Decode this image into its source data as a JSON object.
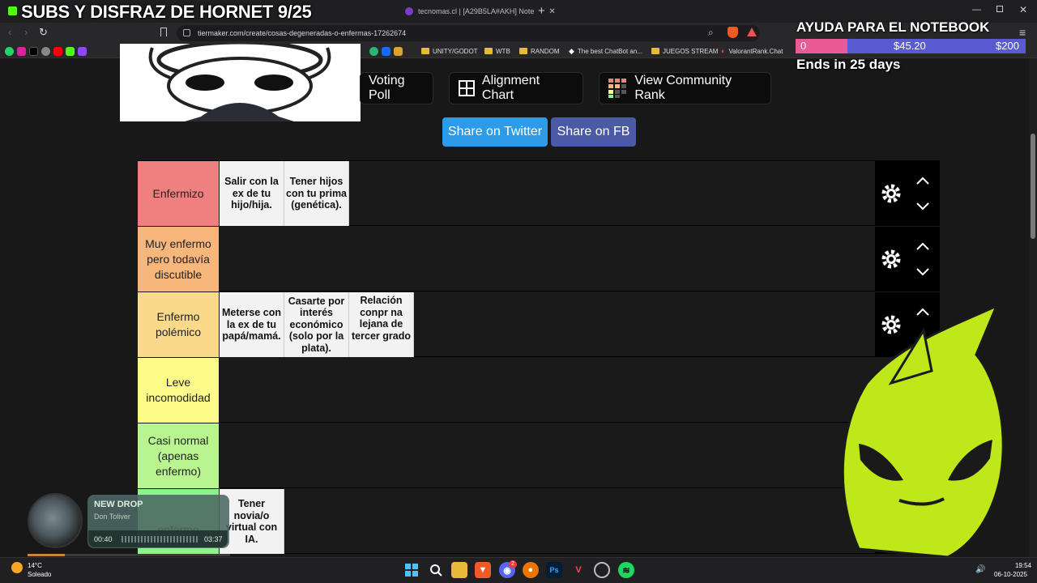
{
  "overlay": {
    "stream_title": "SUBS Y DISFRAZ DE HORNET 9/25",
    "goal_title": "AYUDA PARA EL NOTEBOOK",
    "goal_current": "$45.20",
    "goal_start": "0",
    "goal_target": "$200",
    "goal_progress": 0.226,
    "goal_ends": "Ends in 25 days"
  },
  "browser": {
    "tabs": [
      {
        "label": "tecnomas.cl | [A29B5LA#AKH] Note"
      }
    ],
    "url": "tiermaker.com/create/cosas-degeneradas-o-enfermas-17262674",
    "bookmarks": [
      "UNITY/GODOT",
      "WTB",
      "RANDOM",
      "The best ChatBot an...",
      "JUEGOS STREAM",
      "ValorantRank.Chat"
    ]
  },
  "toolbar": {
    "voting_poll": "Voting Poll",
    "alignment_chart": "Alignment Chart",
    "community_rank": "View Community Rank",
    "share_twitter": "Share on Twitter",
    "share_fb": "Share on FB"
  },
  "tiers": [
    {
      "label": "Enfermizo",
      "color": "#f08080",
      "items": [
        "Salir con la ex de tu hijo/hija.",
        "Tener hijos con tu prima (genética)."
      ]
    },
    {
      "label": "Muy enfermo pero todavía discutible",
      "color": "#f7b77c",
      "items": []
    },
    {
      "label": "Enfermo polémico",
      "color": "#fbd98a",
      "items": [
        "Meterse con la ex de tu papá/mamá.",
        "Casarte por interés económico (solo por la plata).",
        "Relación conpr na lejana de tercer grado"
      ]
    },
    {
      "label": "Leve incomodidad",
      "color": "#fdfc8a",
      "items": []
    },
    {
      "label": "Casi normal (apenas enfermo)",
      "color": "#b9f58f",
      "items": []
    },
    {
      "label": "enfermo",
      "color": "#8ef38e",
      "items": [
        "Tener novia/o virtual con IA."
      ]
    }
  ],
  "music": {
    "title": "NEW DROP",
    "artist": "Don Toliver",
    "elapsed": "00:40",
    "duration": "03:37",
    "progress": 0.184
  },
  "taskbar": {
    "weather_temp": "14°C",
    "weather_desc": "Soleado",
    "time": "19:54",
    "date": "06-10-2025",
    "discord_badge": "2"
  }
}
